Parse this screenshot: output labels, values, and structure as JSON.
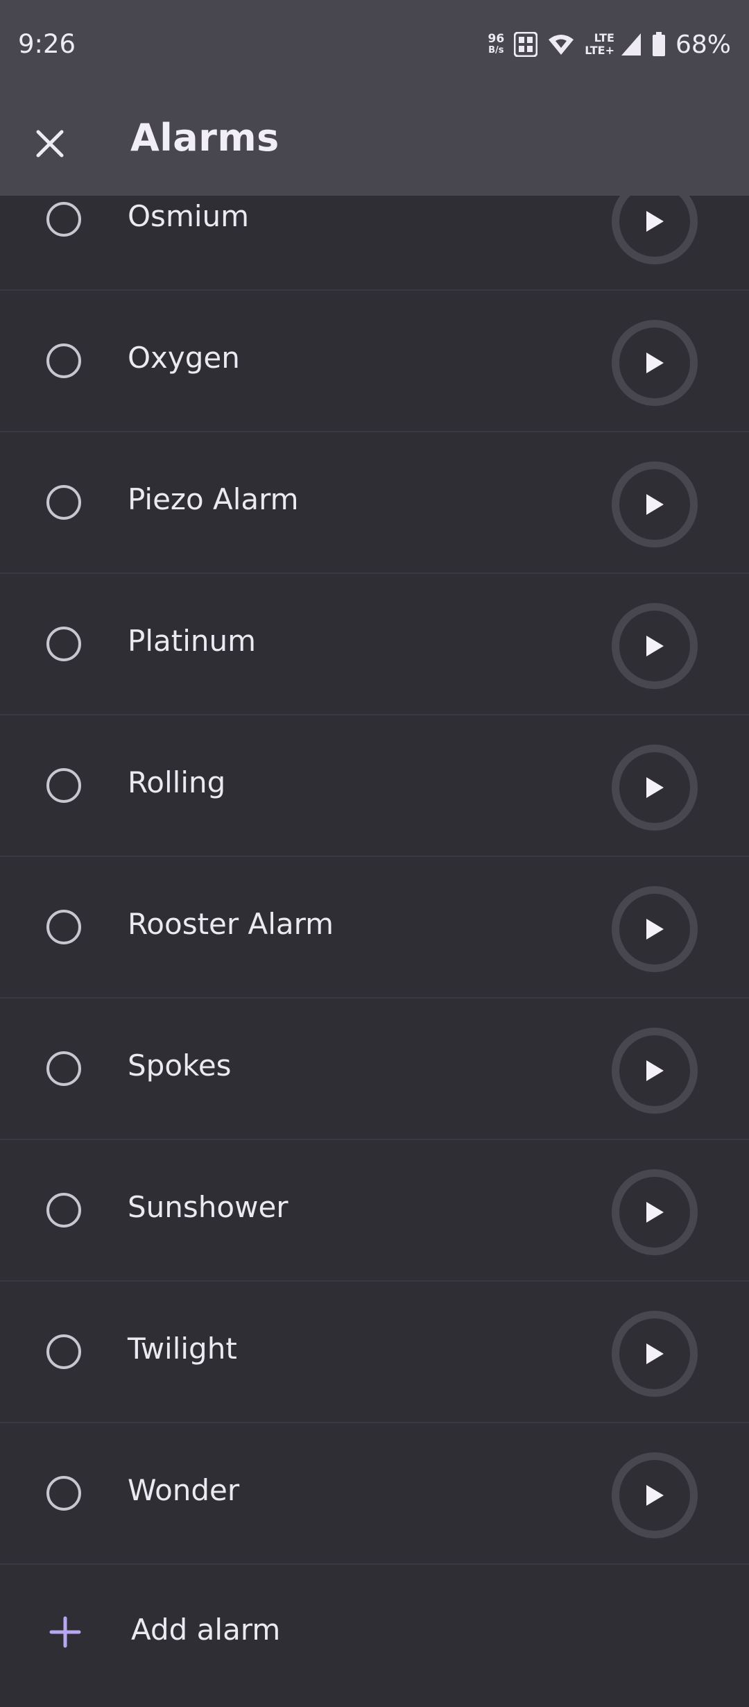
{
  "status_bar": {
    "time": "9:26",
    "net_speed_value": "96",
    "net_speed_unit": "B/s",
    "lte_top": "LTE",
    "lte_bottom": "LTE+",
    "battery": "68%"
  },
  "app_bar": {
    "title": "Alarms"
  },
  "alarms": [
    {
      "label": "Osmium"
    },
    {
      "label": "Oxygen"
    },
    {
      "label": "Piezo Alarm"
    },
    {
      "label": "Platinum"
    },
    {
      "label": "Rolling"
    },
    {
      "label": "Rooster Alarm"
    },
    {
      "label": "Spokes"
    },
    {
      "label": "Sunshower"
    },
    {
      "label": "Twilight"
    },
    {
      "label": "Wonder"
    }
  ],
  "add_alarm": {
    "label": "Add alarm"
  },
  "colors": {
    "background": "#302e35",
    "app_bar": "#48464f",
    "accent": "#b9a6f0"
  }
}
